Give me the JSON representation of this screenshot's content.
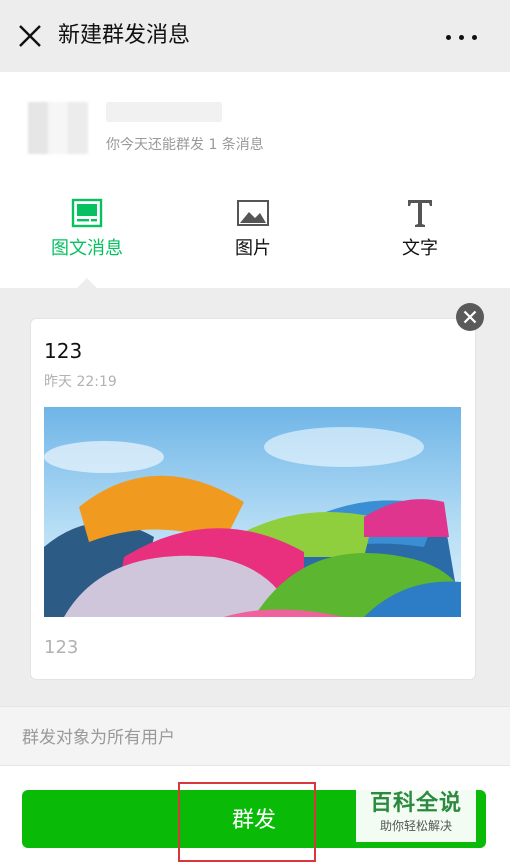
{
  "header": {
    "title": "新建群发消息"
  },
  "account": {
    "quota_text": "你今天还能群发 1 条消息"
  },
  "tabs": [
    {
      "label": "图文消息",
      "active": true,
      "icon": "article-icon"
    },
    {
      "label": "图片",
      "active": false,
      "icon": "image-icon"
    },
    {
      "label": "文字",
      "active": false,
      "icon": "text-icon"
    }
  ],
  "card": {
    "title": "123",
    "time": "昨天 22:19",
    "digest": "123",
    "image": "umbrellas-cover-image"
  },
  "target": {
    "text": "群发对象为所有用户"
  },
  "send": {
    "label": "群发"
  },
  "watermark": {
    "main": "百科全说",
    "sub": "助你轻松解决"
  },
  "colors": {
    "accent": "#07c160",
    "send_button": "#09bb07",
    "highlight": "#d9363e"
  }
}
